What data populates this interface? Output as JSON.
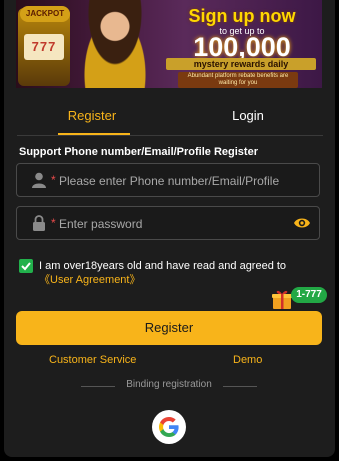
{
  "banner": {
    "jackpot_label": "JACKPOT",
    "reel_symbols": "777",
    "headline": "Sign up now",
    "subline": "to get up to",
    "amount": "100,000",
    "mystery": "mystery rewards daily",
    "fine_print": "Abundant platform rebate benefits are waiting for you"
  },
  "tabs": {
    "register": "Register",
    "login": "Login",
    "active": "register"
  },
  "form": {
    "title": "Support Phone number/Email/Profile Register",
    "phone_placeholder": "Please enter Phone number/Email/Profile",
    "password_placeholder": "Enter password",
    "required_mark": "*",
    "phone_icon": "user-icon",
    "password_icon": "lock-icon",
    "reveal_icon": "eye-icon"
  },
  "agreement": {
    "checked": true,
    "text": "I am over18years old and have read and agreed to ",
    "link": "《User Agreement》"
  },
  "promo": {
    "icon": "gift-icon",
    "badge": "1-777"
  },
  "actions": {
    "register_label": "Register",
    "customer_service": "Customer Service",
    "demo": "Demo"
  },
  "binding": {
    "label": "Binding registration",
    "provider_icon": "google-icon"
  },
  "colors": {
    "accent": "#f8b41a",
    "background": "#1d1d1d",
    "check": "#22b14c"
  }
}
